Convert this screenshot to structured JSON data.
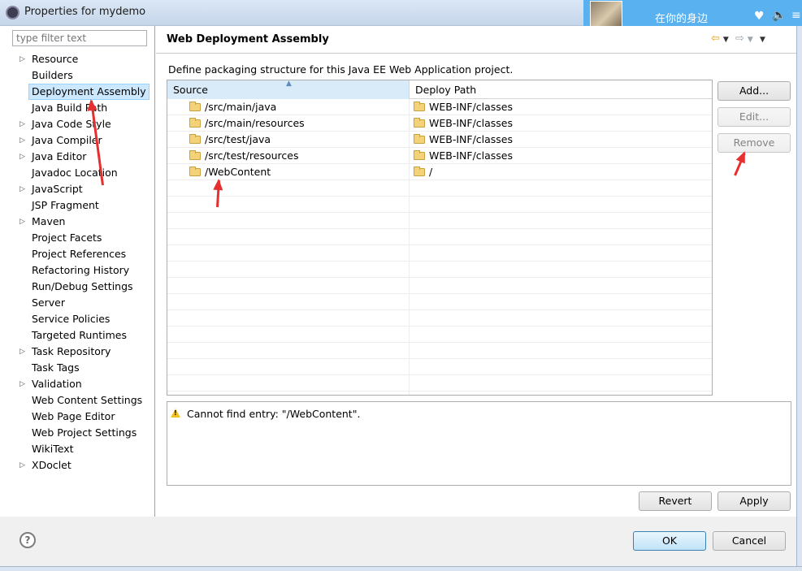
{
  "window": {
    "title": "Properties for mydemo"
  },
  "music_widget": {
    "song": "在你的身边",
    "heart_icon": "heart-icon",
    "volume_icon": "volume-icon",
    "list_icon": "list-icon"
  },
  "sidebar": {
    "filter_placeholder": "type filter text",
    "items": [
      {
        "label": "Resource",
        "expandable": true
      },
      {
        "label": "Builders",
        "expandable": false
      },
      {
        "label": "Deployment Assembly",
        "expandable": false,
        "selected": true
      },
      {
        "label": "Java Build Path",
        "expandable": false
      },
      {
        "label": "Java Code Style",
        "expandable": true
      },
      {
        "label": "Java Compiler",
        "expandable": true
      },
      {
        "label": "Java Editor",
        "expandable": true
      },
      {
        "label": "Javadoc Location",
        "expandable": false
      },
      {
        "label": "JavaScript",
        "expandable": true
      },
      {
        "label": "JSP Fragment",
        "expandable": false
      },
      {
        "label": "Maven",
        "expandable": true
      },
      {
        "label": "Project Facets",
        "expandable": false
      },
      {
        "label": "Project References",
        "expandable": false
      },
      {
        "label": "Refactoring History",
        "expandable": false
      },
      {
        "label": "Run/Debug Settings",
        "expandable": false
      },
      {
        "label": "Server",
        "expandable": false
      },
      {
        "label": "Service Policies",
        "expandable": false
      },
      {
        "label": "Targeted Runtimes",
        "expandable": false
      },
      {
        "label": "Task Repository",
        "expandable": true
      },
      {
        "label": "Task Tags",
        "expandable": false
      },
      {
        "label": "Validation",
        "expandable": true
      },
      {
        "label": "Web Content Settings",
        "expandable": false
      },
      {
        "label": "Web Page Editor",
        "expandable": false
      },
      {
        "label": "Web Project Settings",
        "expandable": false
      },
      {
        "label": "WikiText",
        "expandable": false
      },
      {
        "label": "XDoclet",
        "expandable": true
      }
    ]
  },
  "page": {
    "title": "Web Deployment Assembly",
    "description": "Define packaging structure for this Java EE Web Application project.",
    "table": {
      "columns": [
        "Source",
        "Deploy Path"
      ],
      "rows": [
        {
          "source": "/src/main/java",
          "deploy": "WEB-INF/classes"
        },
        {
          "source": "/src/main/resources",
          "deploy": "WEB-INF/classes"
        },
        {
          "source": "/src/test/java",
          "deploy": "WEB-INF/classes"
        },
        {
          "source": "/src/test/resources",
          "deploy": "WEB-INF/classes"
        },
        {
          "source": "/WebContent",
          "deploy": "/"
        }
      ]
    },
    "buttons": {
      "add": "Add...",
      "edit": "Edit...",
      "remove": "Remove"
    },
    "message": "Cannot find entry: \"/WebContent\".",
    "revert": "Revert",
    "apply": "Apply"
  },
  "footer": {
    "ok": "OK",
    "cancel": "Cancel",
    "help_symbol": "?"
  },
  "colors": {
    "selection": "#cce8ff",
    "annotation_arrow": "#e63030",
    "music_bar": "#5ab1ef"
  }
}
